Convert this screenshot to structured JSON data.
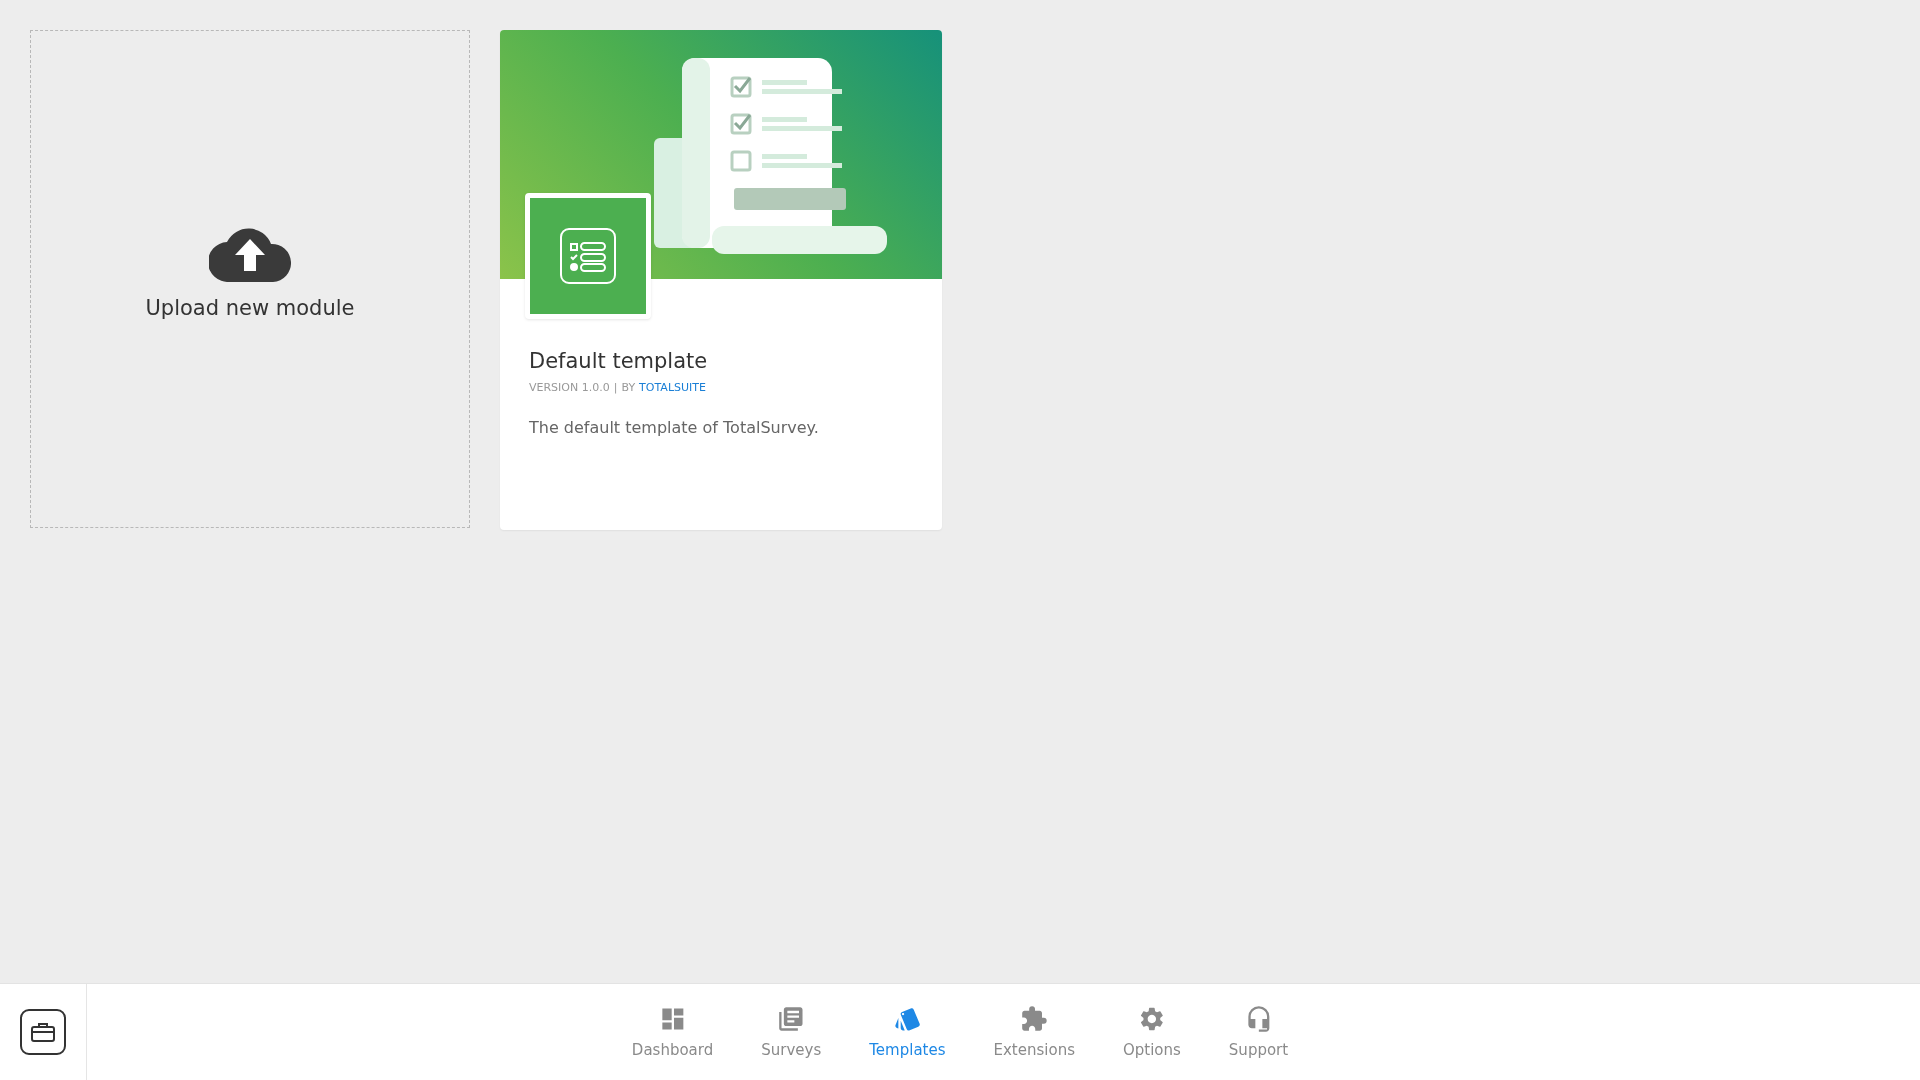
{
  "upload": {
    "label": "Upload new module"
  },
  "templates": [
    {
      "title": "Default template",
      "version": "VERSION 1.0.0",
      "separator": "|",
      "by": "BY",
      "author": "TOTALSUITE",
      "description": "The default template of TotalSurvey."
    }
  ],
  "nav": [
    {
      "kind": "dashboard",
      "label": "Dashboard",
      "selected": false
    },
    {
      "kind": "surveys",
      "label": "Surveys",
      "selected": false
    },
    {
      "kind": "templates",
      "label": "Templates",
      "selected": true
    },
    {
      "kind": "extensions",
      "label": "Extensions",
      "selected": false
    },
    {
      "kind": "options",
      "label": "Options",
      "selected": false
    },
    {
      "kind": "support",
      "label": "Support",
      "selected": false
    }
  ]
}
